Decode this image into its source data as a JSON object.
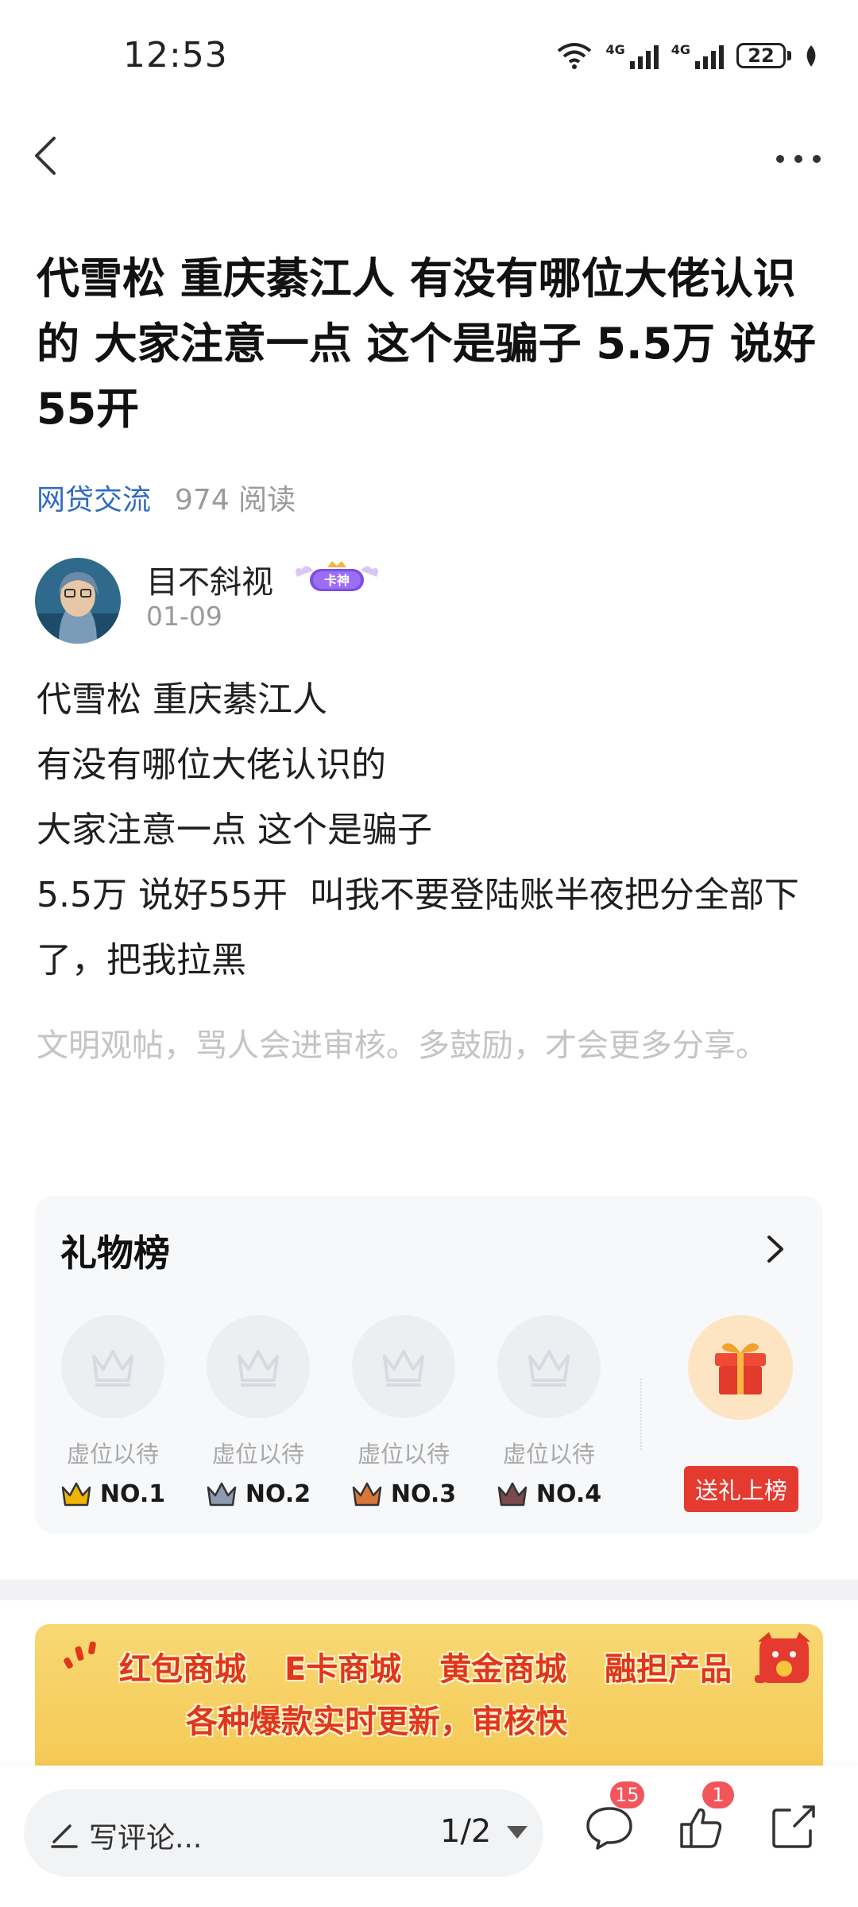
{
  "status_bar": {
    "time": "12:53",
    "signal1": "4G",
    "signal2": "4G",
    "battery": "22"
  },
  "post": {
    "title": "代雪松 重庆綦江人 有没有哪位大佬认识的 大家注意一点 这个是骗子 5.5万 说好55开",
    "category": "网贷交流",
    "read_count": "974 阅读",
    "author": {
      "name": "目不斜视",
      "badge": "卡神",
      "date": "01-09"
    },
    "content": [
      "代雪松 重庆綦江人",
      "有没有哪位大佬认识的",
      "大家注意一点 这个是骗子",
      "5.5万 说好55开  叫我不要登陆账半夜把分全部下了，把我拉黑"
    ],
    "notice": "文明观帖，骂人会进审核。多鼓励，才会更多分享。"
  },
  "gift_board": {
    "title": "礼物榜",
    "slots": [
      {
        "label": "虚位以待",
        "rank": "NO.1",
        "crown_color": "#f0b400"
      },
      {
        "label": "虚位以待",
        "rank": "NO.2",
        "crown_color": "#8e9ab0"
      },
      {
        "label": "虚位以待",
        "rank": "NO.3",
        "crown_color": "#d9763a"
      },
      {
        "label": "虚位以待",
        "rank": "NO.4",
        "crown_color": "#7a4a4a"
      }
    ],
    "send_button": "送礼上榜"
  },
  "banner": {
    "line1": [
      "红包商城",
      "E卡商城",
      "黄金商城",
      "融担产品"
    ],
    "line2": "各种爆款实时更新，审核快"
  },
  "bottom_bar": {
    "comment_placeholder": "写评论...",
    "page_indicator": "1/2",
    "comment_count": "15",
    "like_count": "1"
  },
  "colors": {
    "accent_link": "#2e6bc4",
    "gift_button": "#e53a2f",
    "badge": "#f2555a"
  }
}
